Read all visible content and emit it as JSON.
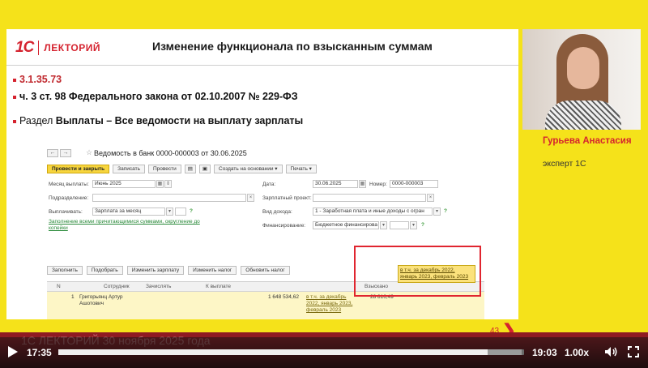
{
  "slide": {
    "logo_1c": "1С",
    "logo_text": "ЛЕКТОРИЙ",
    "title": "Изменение функционала по взысканным суммам",
    "bullet1": "3.1.35.73",
    "bullet2": "ч. 3 ст. 98 Федерального закона от 02.10.2007 № 229-ФЗ",
    "bullet3_prefix": "Раздел ",
    "bullet3_bold": "Выплаты – Все ведомости на выплату зарплаты",
    "page_number": "43",
    "next_arrow": "❯"
  },
  "form": {
    "title": "Ведомость в банк 0000-000003 от 30.06.2025",
    "nav_back": "←",
    "nav_forward": "→",
    "star": "☆",
    "toolbar": {
      "post_close": "Провести и закрыть",
      "save": "Записать",
      "post": "Провести",
      "create_based": "Создать на основании ▾",
      "print": "Печать ▾"
    },
    "fields": {
      "month_label": "Месяц выплаты:",
      "month_value": "Июнь 2025",
      "division_label": "Подразделение:",
      "pay_label": "Выплачивать:",
      "pay_value": "Зарплата за месяц",
      "date_label": "Дата:",
      "date_value": "30.06.2025",
      "number_label": "Номер:",
      "number_value": "0000-000003",
      "salary_project_label": "Зарплатный проект:",
      "income_type_label": "Вид дохода:",
      "income_type_value": "1 - Заработная плата и иные доходы с огран",
      "financing_label": "Финансирование:",
      "financing_value": "Бюджетное финансирова",
      "question": "?"
    },
    "fill_link": "Заполнение всеми причитающимися суммами, округление до копейки",
    "buttons": {
      "fill": "Заполнить",
      "select": "Подобрать",
      "change_salary": "Изменить зарплату",
      "change_tax": "Изменить налог",
      "update_tax": "Обновить налог"
    },
    "table": {
      "headers": [
        "N",
        "Сотрудник",
        "Зачислять",
        "К выплате",
        "Взыскано"
      ],
      "row": {
        "n": "1",
        "employee": "Григорьянц Артур Ашотович",
        "to_pay": "1 648 534,62",
        "to_pay_note": "в т.ч. за декабрь 2022, январь 2023, февраль 2023",
        "withheld": "28 816,49",
        "withheld_note": "в т.ч. за декабрь 2022, январь 2023, февраль 2023"
      }
    }
  },
  "speaker": {
    "name": "Гурьева Анастасия",
    "role": "эксперт 1С"
  },
  "banner_text": "1С ЛЕКТОРИЙ     30 ноября 2025 года",
  "player": {
    "current_time": "17:35",
    "total_time": "19:03",
    "speed": "1.00x",
    "progress": 0.922,
    "buffered": 0.995
  },
  "colors": {
    "accent": "#d5232f",
    "background": "#f5e21a",
    "band": "#8f1a22"
  }
}
